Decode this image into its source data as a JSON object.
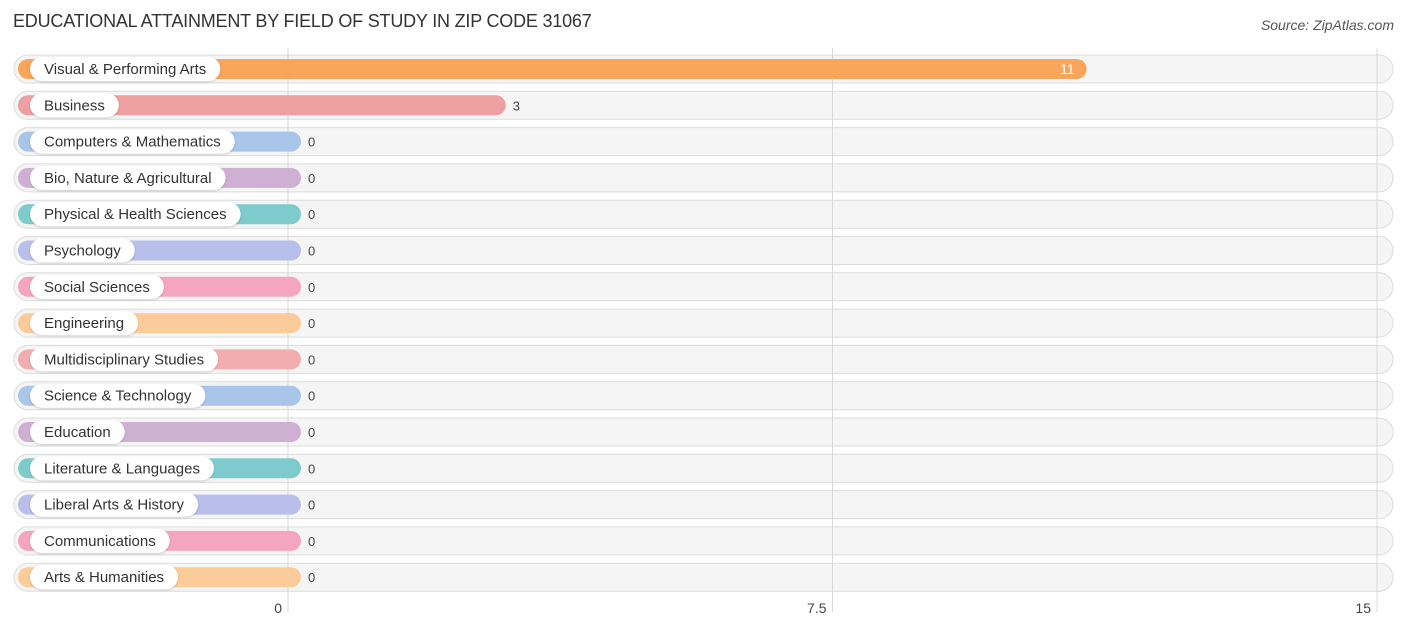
{
  "header": {
    "title": "EDUCATIONAL ATTAINMENT BY FIELD OF STUDY IN ZIP CODE 31067",
    "source": "Source: ZipAtlas.com"
  },
  "chart_data": {
    "type": "bar",
    "orientation": "horizontal",
    "title": "EDUCATIONAL ATTAINMENT BY FIELD OF STUDY IN ZIP CODE 31067",
    "xlabel": "",
    "ylabel": "",
    "xlim": [
      0,
      15
    ],
    "xticks": [
      0,
      7.5,
      15
    ],
    "xtick_labels": [
      "0",
      "7.5",
      "15"
    ],
    "grid": true,
    "categories": [
      "Visual & Performing Arts",
      "Business",
      "Computers & Mathematics",
      "Bio, Nature & Agricultural",
      "Physical & Health Sciences",
      "Psychology",
      "Social Sciences",
      "Engineering",
      "Multidisciplinary Studies",
      "Science & Technology",
      "Education",
      "Literature & Languages",
      "Liberal Arts & History",
      "Communications",
      "Arts & Humanities"
    ],
    "values": [
      11,
      3,
      0,
      0,
      0,
      0,
      0,
      0,
      0,
      0,
      0,
      0,
      0,
      0,
      0
    ],
    "colors": [
      "#f9a65a",
      "#ee9f9f",
      "#a9c6ea",
      "#cfb0d4",
      "#7ecbce",
      "#b7bfea",
      "#f6a5c0",
      "#fccb9a",
      "#f2aeae",
      "#a9c6ea",
      "#cfb0d4",
      "#7ecbce",
      "#b7bfea",
      "#f6a5c0",
      "#fccb9a"
    ]
  }
}
